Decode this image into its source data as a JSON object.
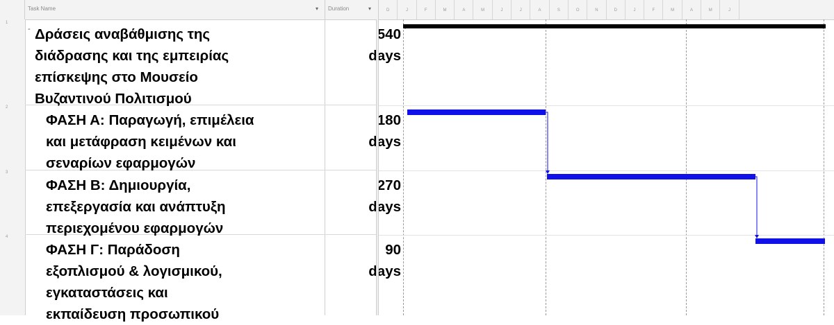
{
  "columns": {
    "task_name": "Task Name",
    "duration": "Duration"
  },
  "timescale": [
    "D",
    "J",
    "F",
    "M",
    "A",
    "M",
    "J",
    "J",
    "A",
    "S",
    "O",
    "N",
    "D",
    "J",
    "F",
    "M",
    "A",
    "M",
    "J"
  ],
  "tasks": [
    {
      "row": "1",
      "lines": [
        "Δράσεις αναβάθμισης της",
        "διάδρασης και της εμπειρίας",
        "επίσκεψης στο Μουσείο",
        "Βυζαντινού Πολιτισμού"
      ],
      "duration_value": "540",
      "duration_unit": "days"
    },
    {
      "row": "2",
      "lines": [
        "ΦΑΣΗ Α: Παραγωγή, επιμέλεια",
        "και  μετάφραση κειμένων και",
        "σεναρίων εφαρμογών"
      ],
      "duration_value": "180",
      "duration_unit": "days"
    },
    {
      "row": "3",
      "lines": [
        "ΦΑΣΗ Β: Δημιουργία,",
        "επεξεργασία και ανάπτυξη",
        "περιεχομένου εφαρμογών"
      ],
      "duration_value": "270",
      "duration_unit": "days"
    },
    {
      "row": "4",
      "lines": [
        "ΦΑΣΗ Γ: Παράδοση",
        "εξοπλισμού & λογισμικού,",
        "εγκαταστάσεις και",
        "εκπαίδευση προσωπικού"
      ],
      "duration_value": "90",
      "duration_unit": "days"
    }
  ],
  "colors": {
    "task_bar": "#1010e8",
    "summary_bar": "#000000"
  }
}
